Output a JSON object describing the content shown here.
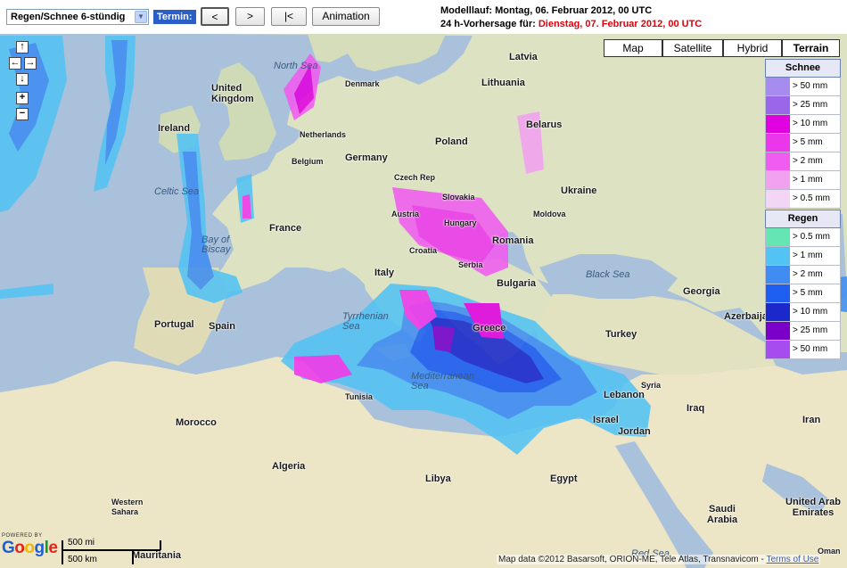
{
  "toolbar": {
    "product_select": "Regen/Schnee 6-stündig",
    "termin_label": "Termin:",
    "prev_label": "<",
    "next_label": ">",
    "first_label": "|<",
    "animation_label": "Animation",
    "model_run_prefix": "Modelllauf: ",
    "model_run_value": "Montag, 06. Februar 2012, 00 UTC",
    "forecast_prefix": "24 h-Vorhersage für: ",
    "forecast_value": "Dienstag, 07. Februar 2012, 00 UTC",
    "forecast_color": "#e0000b"
  },
  "map_types": {
    "map": "Map",
    "satellite": "Satellite",
    "hybrid": "Hybrid",
    "terrain": "Terrain",
    "selected": "Terrain"
  },
  "legend": {
    "snow": {
      "title": "Schnee",
      "items": [
        {
          "label": "> 50 mm",
          "color": "#a78cf0"
        },
        {
          "label": "> 25 mm",
          "color": "#9a66ea"
        },
        {
          "label": "> 10 mm",
          "color": "#e000e0"
        },
        {
          "label": "> 5 mm",
          "color": "#ec36ec"
        },
        {
          "label": "> 2 mm",
          "color": "#f05cef"
        },
        {
          "label": "> 1 mm",
          "color": "#f2a0f0"
        },
        {
          "label": "> 0.5 mm",
          "color": "#f3d6f5"
        }
      ]
    },
    "rain": {
      "title": "Regen",
      "items": [
        {
          "label": "> 0.5 mm",
          "color": "#66e5b4"
        },
        {
          "label": "> 1 mm",
          "color": "#53c3f4"
        },
        {
          "label": "> 2 mm",
          "color": "#3f8df2"
        },
        {
          "label": "> 5 mm",
          "color": "#1e5ef0"
        },
        {
          "label": "> 10 mm",
          "color": "#1a28cc"
        },
        {
          "label": "> 25 mm",
          "color": "#7a00c8"
        },
        {
          "label": "> 50 mm",
          "color": "#a64df0"
        }
      ]
    }
  },
  "map_labels": {
    "countries": [
      "Latvia",
      "Lithuania",
      "United Kingdom",
      "Ireland",
      "Denmark",
      "Netherlands",
      "Belgium",
      "Germany",
      "Poland",
      "Belarus",
      "Czech Rep",
      "Slovakia",
      "Ukraine",
      "France",
      "Austria",
      "Hungary",
      "Moldova",
      "Romania",
      "Croatia",
      "Serbia",
      "Bulgaria",
      "Italy",
      "Georgia",
      "Azerbaija",
      "Portugal",
      "Spain",
      "Greece",
      "Turkey",
      "Syria",
      "Lebanon",
      "Israel",
      "Jordan",
      "Iraq",
      "Iran",
      "Tunisia",
      "Morocco",
      "Algeria",
      "Libya",
      "Egypt",
      "Western Sahara",
      "Saudi Arabia",
      "United Arab Emirates",
      "Oman",
      "Mauritania"
    ],
    "seas": [
      "North Sea",
      "Celtic Sea",
      "Bay of Biscay",
      "Tyrrhenian Sea",
      "Mediterranean Sea",
      "Black Sea",
      "Red Sea"
    ]
  },
  "scale": {
    "miles": "500 mi",
    "km": "500 km"
  },
  "branding": {
    "powered": "POWERED BY",
    "google": "Google"
  },
  "attribution": {
    "text": "Map data ©2012 Basarsoft, ORION-ME, Tele Atlas, Transnavicom - ",
    "terms": "Terms of Use"
  },
  "nav_icons": [
    "pan-up-icon",
    "pan-left-icon",
    "pan-right-icon",
    "pan-down-icon",
    "zoom-in-icon",
    "zoom-out-icon"
  ]
}
